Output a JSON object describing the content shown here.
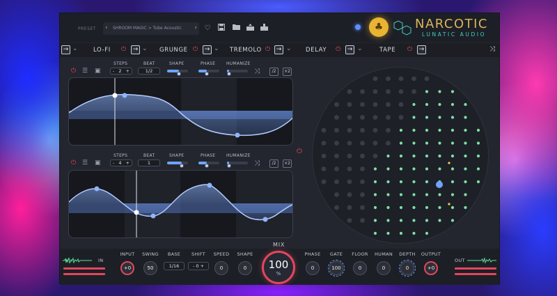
{
  "preset": {
    "label": "PRESET",
    "name": "SHROOM MAGIC > Tube Acoustic",
    "prev": "‹",
    "next": "›"
  },
  "toolbar_icons": [
    "heart-icon",
    "save-icon",
    "folder-icon",
    "export-icon",
    "import-icon"
  ],
  "brand": {
    "title": "NARCOTIC",
    "subtitle": "LUNATIC AUDIO"
  },
  "fx_chain": {
    "arrow": "→",
    "chevron": "⌄",
    "power": "⏻",
    "shuffle": "⤨",
    "modules": [
      {
        "label": "LO-FI"
      },
      {
        "label": "GRUNGE"
      },
      {
        "label": "TREMOLO"
      },
      {
        "label": "DELAY"
      },
      {
        "label": "TAPE"
      }
    ]
  },
  "lfo": [
    {
      "steps_label": "STEPS",
      "steps_value": "2",
      "steps_minus": "-",
      "steps_plus": "+",
      "beat_label": "BEAT",
      "beat_value": "1/2",
      "shape_label": "SHAPE",
      "shape_level": 0.55,
      "phase_label": "PHASE",
      "phase_level": 0.4,
      "humanize_label": "HUMANIZE",
      "humanize_level": 0.1,
      "btn_a": "/2",
      "btn_b": "×2"
    },
    {
      "steps_label": "STEPS",
      "steps_value": "4",
      "steps_minus": "-",
      "steps_plus": "+",
      "beat_label": "BEAT",
      "beat_value": "1",
      "shape_label": "SHAPE",
      "shape_level": 0.7,
      "phase_label": "PHASE",
      "phase_level": 0.4,
      "humanize_label": "HUMANIZE",
      "humanize_level": 0.1,
      "btn_a": "/2",
      "btn_b": "×2"
    }
  ],
  "power_glyph": "⏻",
  "bottom": {
    "in_label": "IN",
    "out_label": "OUT",
    "input": {
      "label": "INPUT",
      "value": "+0"
    },
    "swing": {
      "label": "SWING",
      "value": "50"
    },
    "base": {
      "label": "BASE",
      "value": "1/16"
    },
    "shift": {
      "label": "SHIFT",
      "value": "- 0 +"
    },
    "speed": {
      "label": "SPEED",
      "value": "0"
    },
    "shape": {
      "label": "SHAPE",
      "value": "0"
    },
    "mix": {
      "label": "MIX",
      "value": "100",
      "unit": "%"
    },
    "phase": {
      "label": "PHASE",
      "value": "0"
    },
    "gate": {
      "label": "GATE",
      "value": "100"
    },
    "floor": {
      "label": "FLOOR",
      "value": "0"
    },
    "human": {
      "label": "HUMAN",
      "value": "0"
    },
    "depth": {
      "label": "DEPTH",
      "value": "0"
    },
    "output": {
      "label": "OUTPUT",
      "value": "+0"
    }
  },
  "colors": {
    "accent_red": "#e2475d",
    "accent_blue": "#6fa4ff",
    "brand_gold": "#d9b45a",
    "brand_teal": "#3fd1c5",
    "dot_green": "#7fe0a8"
  }
}
